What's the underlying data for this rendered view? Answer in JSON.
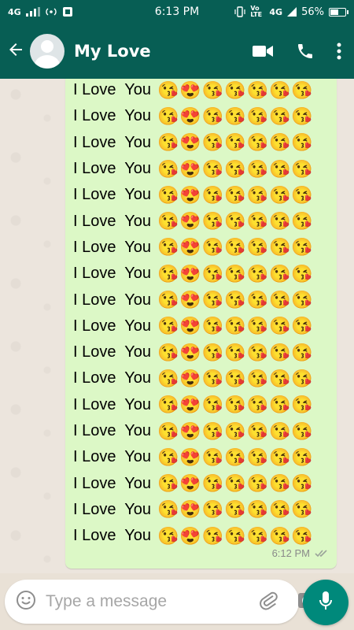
{
  "status_bar": {
    "network_left": "4G",
    "time": "6:13 PM",
    "network_right": "4G",
    "volte": "Vo LTE",
    "battery": "56%",
    "battery_level": 0.56
  },
  "app_bar": {
    "contact_name": "My Love",
    "icons": [
      "back-arrow-icon",
      "avatar",
      "video-call-icon",
      "phone-call-icon",
      "more-options-icon"
    ]
  },
  "message": {
    "lines": [
      "I Love  You",
      "I Love  You",
      "I Love  You",
      "I Love  You",
      "I Love  You",
      "I Love  You",
      "I Love  You",
      "I Love  You",
      "I Love  You",
      "I Love  You",
      "I Love  You",
      "I Love  You",
      "I Love  You",
      "I Love  You",
      "I Love  You",
      "I Love  You",
      "I Love  You",
      "I Love  You"
    ],
    "emojis": "😘😍😘😘😘😘😘",
    "time": "6:12 PM",
    "status": "read"
  },
  "composer": {
    "placeholder": "Type a message",
    "icons": [
      "emoji-icon",
      "attach-icon",
      "camera-icon",
      "mic-icon"
    ]
  },
  "colors": {
    "header": "#075e54",
    "bubble": "#dcf8c6",
    "mic_button": "#00897b"
  }
}
